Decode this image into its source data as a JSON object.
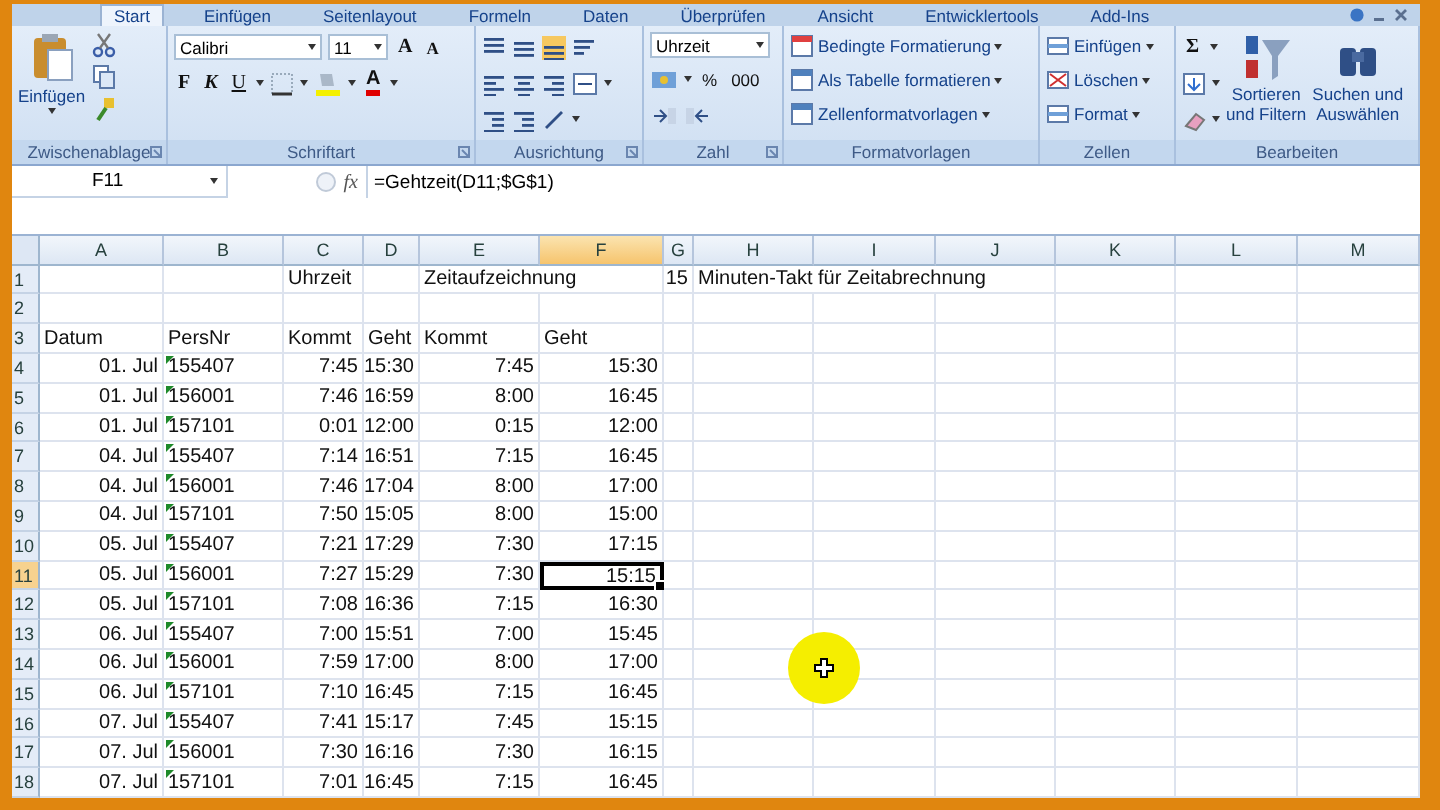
{
  "tabs": [
    {
      "label": "Start",
      "selected": true
    },
    {
      "label": "Einfügen",
      "selected": false
    },
    {
      "label": "Seitenlayout",
      "selected": false
    },
    {
      "label": "Formeln",
      "selected": false
    },
    {
      "label": "Daten",
      "selected": false
    },
    {
      "label": "Überprüfen",
      "selected": false
    },
    {
      "label": "Ansicht",
      "selected": false
    },
    {
      "label": "Entwicklertools",
      "selected": false
    },
    {
      "label": "Add-Ins",
      "selected": false
    }
  ],
  "ribbon": {
    "clipboard": {
      "paste": "Einfügen",
      "label": "Zwischenablage"
    },
    "font": {
      "name": "Calibri",
      "size": "11",
      "grow": "A",
      "shrink": "A",
      "bold": "F",
      "italic": "K",
      "underline": "U",
      "font_color_letter": "A",
      "label": "Schriftart"
    },
    "alignment": {
      "label": "Ausrichtung"
    },
    "number": {
      "format": "Uhrzeit",
      "percent": "%",
      "thousands": "000",
      "label": "Zahl"
    },
    "styles": {
      "items": [
        "Bedingte Formatierung",
        "Als Tabelle formatieren",
        "Zellenformatvorlagen"
      ],
      "label": "Formatvorlagen"
    },
    "cells": {
      "items": [
        "Einfügen",
        "Löschen",
        "Format"
      ],
      "label": "Zellen"
    },
    "editing": {
      "sum": "Σ",
      "sort": [
        "Sortieren",
        "und Filtern"
      ],
      "find": [
        "Suchen und",
        "Auswählen"
      ],
      "label": "Bearbeiten"
    }
  },
  "formula_bar": {
    "name_box": "F11",
    "fx": "fx",
    "formula": "=Gehtzeit(D11;$G$1)"
  },
  "sheet": {
    "columns": [
      {
        "label": "A",
        "selected": false
      },
      {
        "label": "B",
        "selected": false
      },
      {
        "label": "C",
        "selected": false
      },
      {
        "label": "D",
        "selected": false
      },
      {
        "label": "E",
        "selected": false
      },
      {
        "label": "F",
        "selected": true
      },
      {
        "label": "G",
        "selected": false
      },
      {
        "label": "H",
        "selected": false
      },
      {
        "label": "I",
        "selected": false
      },
      {
        "label": "J",
        "selected": false
      },
      {
        "label": "K",
        "selected": false
      },
      {
        "label": "L",
        "selected": false
      },
      {
        "label": "M",
        "selected": false
      }
    ],
    "rows": [
      {
        "label": "1",
        "selected": false,
        "kind": "title",
        "cells": {
          "C": "Uhrzeit",
          "E": "Zeitaufzeichnung",
          "G": "15",
          "H": "Minuten-Takt für Zeitabrechnung"
        }
      },
      {
        "label": "2",
        "selected": false,
        "kind": "header",
        "cells": {}
      },
      {
        "label": "3",
        "selected": false,
        "kind": "header",
        "cells": {
          "A": "Datum",
          "B": "PersNr",
          "C": "Kommt",
          "D": "Geht",
          "E": "Kommt",
          "F": "Geht"
        }
      },
      {
        "label": "4",
        "selected": false,
        "kind": "data",
        "text_number_flag": true,
        "cells": {
          "A": "01. Jul",
          "B": "155407",
          "C": "7:45",
          "D": "15:30",
          "E": "7:45",
          "F": "15:30"
        }
      },
      {
        "label": "5",
        "selected": false,
        "kind": "data",
        "text_number_flag": true,
        "cells": {
          "A": "01. Jul",
          "B": "156001",
          "C": "7:46",
          "D": "16:59",
          "E": "8:00",
          "F": "16:45"
        }
      },
      {
        "label": "6",
        "selected": false,
        "kind": "data",
        "text_number_flag": true,
        "cells": {
          "A": "01. Jul",
          "B": "157101",
          "C": "0:01",
          "D": "12:00",
          "E": "0:15",
          "F": "12:00"
        }
      },
      {
        "label": "7",
        "selected": false,
        "kind": "data",
        "text_number_flag": true,
        "cells": {
          "A": "04. Jul",
          "B": "155407",
          "C": "7:14",
          "D": "16:51",
          "E": "7:15",
          "F": "16:45"
        }
      },
      {
        "label": "8",
        "selected": false,
        "kind": "data",
        "text_number_flag": true,
        "cells": {
          "A": "04. Jul",
          "B": "156001",
          "C": "7:46",
          "D": "17:04",
          "E": "8:00",
          "F": "17:00"
        }
      },
      {
        "label": "9",
        "selected": false,
        "kind": "data",
        "text_number_flag": true,
        "cells": {
          "A": "04. Jul",
          "B": "157101",
          "C": "7:50",
          "D": "15:05",
          "E": "8:00",
          "F": "15:00"
        }
      },
      {
        "label": "10",
        "selected": false,
        "kind": "data",
        "text_number_flag": true,
        "cells": {
          "A": "05. Jul",
          "B": "155407",
          "C": "7:21",
          "D": "17:29",
          "E": "7:30",
          "F": "17:15"
        }
      },
      {
        "label": "11",
        "selected": true,
        "kind": "data",
        "text_number_flag": true,
        "cells": {
          "A": "05. Jul",
          "B": "156001",
          "C": "7:27",
          "D": "15:29",
          "E": "7:30",
          "F": "15:15"
        }
      },
      {
        "label": "12",
        "selected": false,
        "kind": "data",
        "text_number_flag": true,
        "cells": {
          "A": "05. Jul",
          "B": "157101",
          "C": "7:08",
          "D": "16:36",
          "E": "7:15",
          "F": "16:30"
        }
      },
      {
        "label": "13",
        "selected": false,
        "kind": "data",
        "text_number_flag": true,
        "cells": {
          "A": "06. Jul",
          "B": "155407",
          "C": "7:00",
          "D": "15:51",
          "E": "7:00",
          "F": "15:45"
        }
      },
      {
        "label": "14",
        "selected": false,
        "kind": "data",
        "text_number_flag": true,
        "cells": {
          "A": "06. Jul",
          "B": "156001",
          "C": "7:59",
          "D": "17:00",
          "E": "8:00",
          "F": "17:00"
        }
      },
      {
        "label": "15",
        "selected": false,
        "kind": "data",
        "text_number_flag": true,
        "cells": {
          "A": "06. Jul",
          "B": "157101",
          "C": "7:10",
          "D": "16:45",
          "E": "7:15",
          "F": "16:45"
        }
      },
      {
        "label": "16",
        "selected": false,
        "kind": "data",
        "text_number_flag": true,
        "cells": {
          "A": "07. Jul",
          "B": "155407",
          "C": "7:41",
          "D": "15:17",
          "E": "7:45",
          "F": "15:15"
        }
      },
      {
        "label": "17",
        "selected": false,
        "kind": "data",
        "text_number_flag": true,
        "cells": {
          "A": "07. Jul",
          "B": "156001",
          "C": "7:30",
          "D": "16:16",
          "E": "7:30",
          "F": "16:15"
        }
      },
      {
        "label": "18",
        "selected": false,
        "kind": "data",
        "text_number_flag": true,
        "cells": {
          "A": "07. Jul",
          "B": "157101",
          "C": "7:01",
          "D": "16:45",
          "E": "7:15",
          "F": "16:45"
        }
      }
    ]
  }
}
